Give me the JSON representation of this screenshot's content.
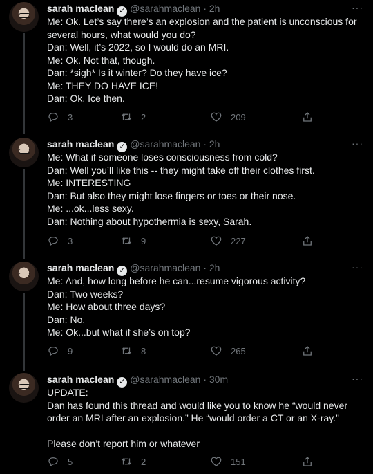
{
  "tweets": [
    {
      "name": "sarah maclean",
      "handle": "@sarahmaclean",
      "time": "· 2h",
      "more": "···",
      "lines": [
        "Me: Ok. Let’s say there’s an explosion and the patient is unconscious for",
        "several hours, what would you do?",
        "Dan: Well, it’s 2022, so I would do an MRI.",
        "Me: Ok. Not that, though.",
        "Dan: *sigh* Is it winter? Do they have ice?",
        "Me: THEY DO HAVE ICE!",
        "Dan: Ok. Ice then."
      ],
      "replies": "3",
      "retweets": "2",
      "likes": "209"
    },
    {
      "name": "sarah maclean",
      "handle": "@sarahmaclean",
      "time": "· 2h",
      "more": "···",
      "lines": [
        "Me: What if someone loses consciousness from cold?",
        "Dan: Well you’ll like this -- they might take off their clothes first.",
        "Me: INTERESTING",
        "Dan: But also they might lose fingers or toes or their nose.",
        "Me: ...ok...less sexy.",
        "Dan: Nothing about hypothermia is sexy, Sarah."
      ],
      "replies": "3",
      "retweets": "9",
      "likes": "227"
    },
    {
      "name": "sarah maclean",
      "handle": "@sarahmaclean",
      "time": "· 2h",
      "more": "···",
      "lines": [
        "Me: And, how long before he can...resume vigorous activity?",
        "Dan: Two weeks?",
        "Me: How about three days?",
        "Dan: No.",
        "Me: Ok...but what if she’s on top?"
      ],
      "replies": "9",
      "retweets": "8",
      "likes": "265"
    },
    {
      "name": "sarah maclean",
      "handle": "@sarahmaclean",
      "time": "· 30m",
      "more": "···",
      "lines": [
        "UPDATE:",
        "Dan has found this thread and would like you to know he “would never",
        "order an MRI after an explosion.” He “would order a CT or an X-ray.”",
        " ",
        "Please don’t report him or whatever"
      ],
      "replies": "5",
      "retweets": "2",
      "likes": "151"
    }
  ]
}
